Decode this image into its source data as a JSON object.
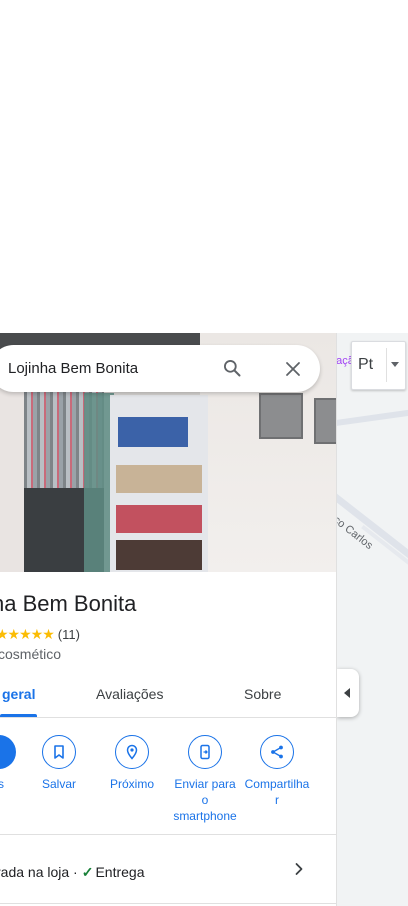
{
  "search": {
    "query": "Lojinha Bem Bonita"
  },
  "map": {
    "street_label": "isco Carlos",
    "poi_label": "baçã",
    "layers_label": "Pt"
  },
  "place": {
    "name": "ha Bem Bonita",
    "rating": "★★★★★",
    "review_count": "(11)",
    "category": "cosmético"
  },
  "tabs": [
    {
      "label": "geral",
      "active": true
    },
    {
      "label": "Avaliações",
      "active": false
    },
    {
      "label": "Sobre",
      "active": false
    }
  ],
  "actions": {
    "first_fragment": "s",
    "save": "Salvar",
    "nearby": "Próximo",
    "send_line1": "Enviar para",
    "send_line2": "o",
    "send_line3": "smartphone",
    "share_line1": "Compartilha",
    "share_line2": "r"
  },
  "info_row": {
    "prefix": "rada na loja ·",
    "check": "✓",
    "delivery": "Entrega"
  },
  "colors": {
    "accent": "#1a73e8",
    "star": "#fbbc04",
    "check": "#188038"
  }
}
